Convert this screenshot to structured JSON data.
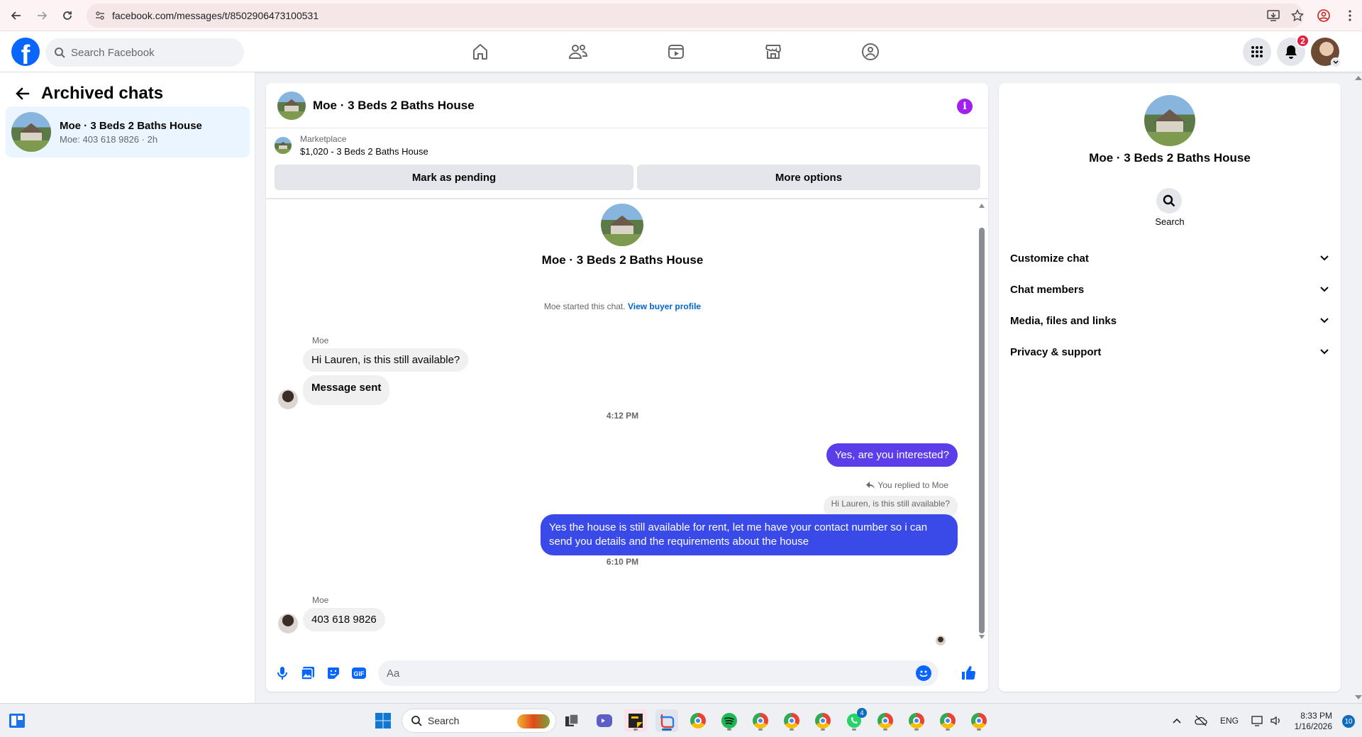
{
  "browser": {
    "url": "facebook.com/messages/t/8502906473100531"
  },
  "topbar": {
    "search_placeholder": "Search Facebook",
    "notification_count": "2"
  },
  "sidebar": {
    "title": "Archived chats",
    "chats": [
      {
        "name": "Moe · 3 Beds 2 Baths House",
        "preview": "Moe: 403 618 9826 · 2h"
      }
    ]
  },
  "conversation": {
    "title": "Moe · 3 Beds 2 Baths House",
    "marketplace_label": "Marketplace",
    "listing": "$1,020 - 3 Beds 2 Baths House",
    "mark_pending_label": "Mark as pending",
    "more_options_label": "More options",
    "intro_name": "Moe · 3 Beds 2 Baths House",
    "started_text": "Moe started this chat.",
    "view_profile_label": "View buyer profile",
    "messages": {
      "sender1": "Moe",
      "in1": "Hi Lauren, is this still available?",
      "in2": "Message sent",
      "time1": "4:12 PM",
      "out1": "Yes, are you interested?",
      "reply_note": "You replied to Moe",
      "quoted": "Hi Lauren, is this still available?",
      "out2": "Yes the house is still available for rent, let me have your contact number so i can send you details and the requirements about the house",
      "time2": "6:10 PM",
      "sender2": "Moe",
      "in3": "403 618 9826"
    },
    "composer_placeholder": "Aa"
  },
  "details": {
    "name": "Moe · 3 Beds 2 Baths House",
    "search_label": "Search",
    "sections": [
      "Customize chat",
      "Chat members",
      "Media, files and links",
      "Privacy & support"
    ]
  },
  "taskbar": {
    "search_label": "Search",
    "language": "ENG",
    "time": "8:33 PM",
    "date": "1/16/2026",
    "notification_count": "10",
    "whatsapp_badge": "4"
  },
  "colors": {
    "fb_blue": "#0866ff",
    "outgoing_bubble": "#5b3dea",
    "info_purple": "#a020f0",
    "selected_chat_bg": "#ebf5ff"
  }
}
